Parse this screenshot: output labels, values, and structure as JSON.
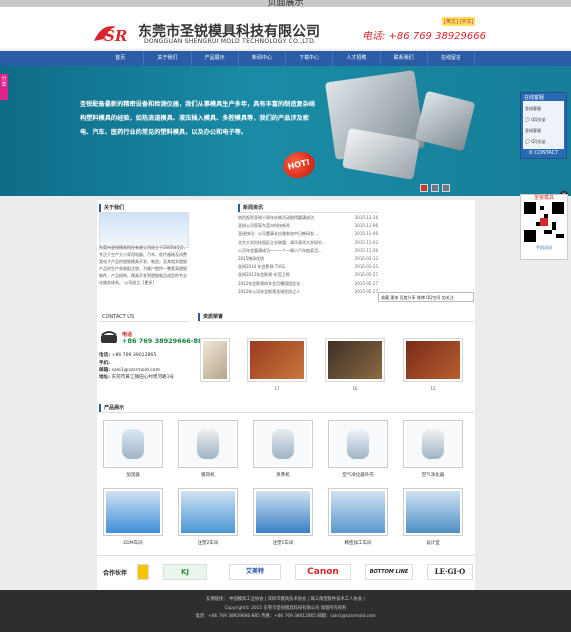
{
  "top_bar": {
    "text": "页面展示"
  },
  "header": {
    "logo_text": "SR",
    "company_cn": "东莞市圣锐模具科技有限公司",
    "company_en": "DONGGUAN SHENGRUI MOLD TECHNOLOGY CO.,LTD.",
    "phone_label": "电话: +86 769 38929666",
    "lang": "[英文] [中文]"
  },
  "nav": {
    "items": [
      "首页",
      "关于我们",
      "产品展示",
      "新闻中心",
      "下载中心",
      "人才招聘",
      "联系我们",
      "在线留言"
    ]
  },
  "banner": {
    "text": "圣锐配备最新的精密设备和检测仪器，我们从事模具生产多年，具有丰富的制造复杂结构塑料模具的经验，如热流道模具、液压插入模具、多腔模具等，我们的产品涉及家电、汽车、医药行业的常见的塑料模具，以及办公和电子等。",
    "badge": "HOT!"
  },
  "side_tab": {
    "text": "分享"
  },
  "cs_panel": {
    "title": "在线客服",
    "items": [
      "圣锐客服",
      "QQ交谈",
      "圣锐客服",
      "QQ交谈"
    ],
    "contact": "CONTACT"
  },
  "qr": {
    "title": "圣锐模具",
    "caption": "手机访问"
  },
  "about": {
    "title": "关于我们",
    "text": "东莞市圣锐模具科技有限公司成立于2005年5月，专注于生产大小家用电器、汽车、医疗器械及消费类电子产品的塑胶模具开发、制造，及其相关塑胶产品的生产和装配注塑，为客户提供一整套高塑胶制件、产品结构、模具开发到塑胶制品成型的专业化服务体系。   公司成立..[更多]"
  },
  "news": {
    "title": "新闻资讯",
    "items": [
      {
        "t": "热烈祝贺圣锐十周年庆典活动取得圆满成功",
        "d": "2015-12-26"
      },
      {
        "t": "圣锐公司荣获东莞市科技新秀",
        "d": "2015-11-06"
      },
      {
        "t": "圣锐快讯：公司董事长应邀参加中日韩研发...",
        "d": "2015-11-06"
      },
      {
        "t": "北京大学科技园区企业联盟、清华清华大学研究...",
        "d": "2015-11-03"
      },
      {
        "t": "公司年会圆满成功——一个一辆小汽车抽奖活...",
        "d": "2015-11-26"
      },
      {
        "t": "2015博采优质",
        "d": "2015-03-13"
      },
      {
        "t": "圣锐2014 年会影视-TVS1",
        "d": "2015-02-25"
      },
      {
        "t": "圣锐2013年会影视-东莞卫视",
        "d": "2015-05-27"
      },
      {
        "t": "2012年会影视的年会月播国国会议",
        "d": "2015-05-27"
      },
      {
        "t": "2012年公司年会影视圣锐优质之人",
        "d": "2015-05-27"
      }
    ]
  },
  "widget": {
    "text": "收藏  惠来  百度分享  微博  QQ空间  加关注"
  },
  "contact": {
    "title": "CONTACT US",
    "tel_label": "电话",
    "tel_number": "+86 769 38929666-885",
    "lines": [
      {
        "k": "电话:",
        "v": "+86 769 39012865"
      },
      {
        "k": "手机:",
        "v": ""
      },
      {
        "k": "邮箱:",
        "v": "sale1@szsrmold.com"
      },
      {
        "k": "地址:",
        "v": "东莞市黄江镇田心村周河路1号"
      }
    ]
  },
  "honors": {
    "title": "资质荣誉",
    "caps": [
      "17",
      "16",
      "15"
    ]
  },
  "products": {
    "title": "产品展示",
    "row1": [
      "加湿器",
      "暖风机",
      "蒸茶机",
      "空气净化器外壳",
      "空气净化器"
    ],
    "row2": [
      "EDM车间",
      "注塑2车间",
      "注塑1车间",
      "精密加工车间",
      "设计室"
    ]
  },
  "partners": {
    "label": "合作伙伴",
    "logos": [
      "KJ",
      "艾美特",
      "Canon",
      "BOTTOM LINE",
      "LE·GI·O"
    ]
  },
  "footer": {
    "line1": "友情链接： 中国模具工业协会 | 深圳市模具技术协会 | 珠三角塑胶件技术工人协会 |",
    "line2": "Copyright© 2015 东莞市圣锐模具科技有限公司 保留所有权利",
    "line3": "电话：+86 769 38929666-885  传真：+86 769 38012865  邮箱：sale1@szsrmold.com"
  }
}
